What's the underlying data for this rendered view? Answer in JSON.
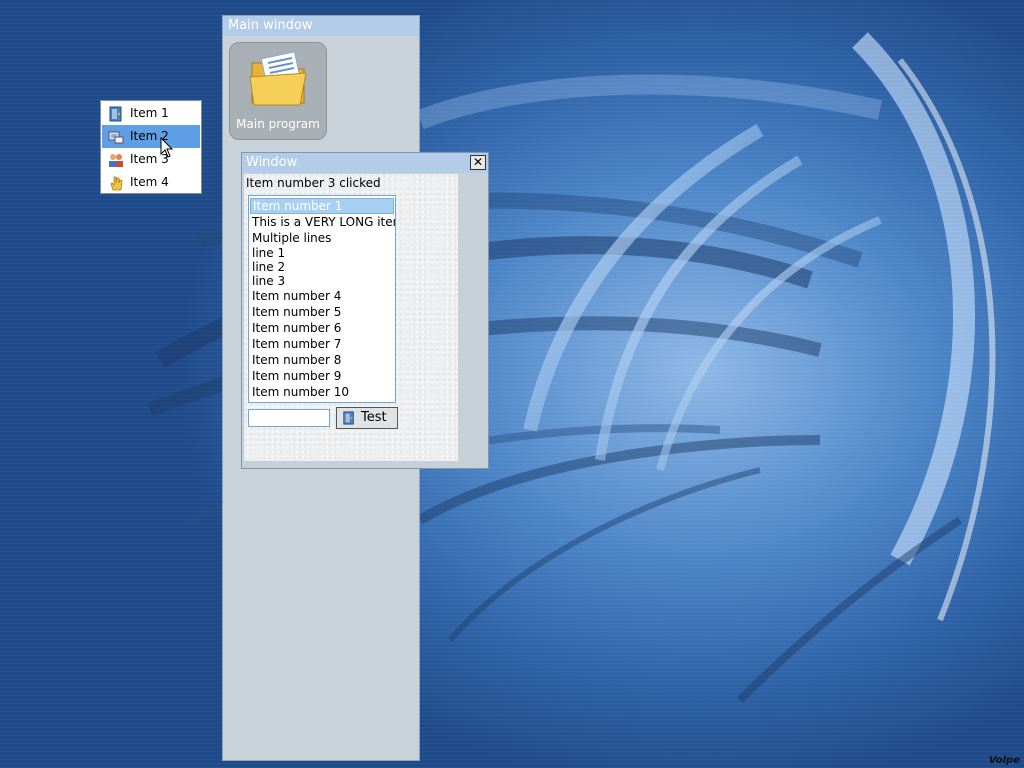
{
  "desktop": {
    "signature": "Volpe"
  },
  "main_window": {
    "title": "Main window",
    "program_icon": {
      "icon": "folder-icon",
      "label": "Main program"
    }
  },
  "popup_menu": {
    "items": [
      {
        "label": "Item 1",
        "icon": "door-icon"
      },
      {
        "label": "Item 2",
        "icon": "computer-icon"
      },
      {
        "label": "Item 3",
        "icon": "users-icon"
      },
      {
        "label": "Item 4",
        "icon": "hand-icon"
      }
    ],
    "selected_index": 1
  },
  "window": {
    "title": "Window",
    "close_label": "✕",
    "status": "Item number 3 clicked",
    "list": [
      "Item number 1",
      "This is a VERY LONG item",
      "Multiple lines",
      "line 1",
      "line 2",
      "line 3",
      "Item number 4",
      "Item number 5",
      "Item number 6",
      "Item number 7",
      "Item number 8",
      "Item number 9",
      "Item number 10"
    ],
    "selected_list_index": 0,
    "input": {
      "value": "",
      "placeholder": ""
    },
    "test_button": {
      "label": "Test",
      "icon": "door-icon"
    }
  },
  "colors": {
    "title_bar": "#b3cde8",
    "menu_highlight": "#5f9fe6",
    "panel": "#c9d2d8"
  }
}
